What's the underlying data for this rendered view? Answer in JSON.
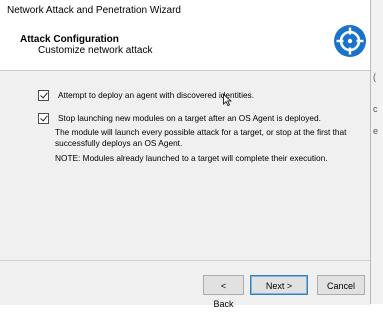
{
  "window": {
    "title": "Network Attack and Penetration Wizard"
  },
  "header": {
    "title": "Attack Configuration",
    "subtitle": "Customize network attack",
    "logo_icon": "crosshair-target-icon"
  },
  "options": [
    {
      "label": "Attempt to deploy an agent with discovered identities.",
      "checked": true
    },
    {
      "label": "Stop launching new modules on a target after an OS Agent is deployed.",
      "checked": true
    }
  ],
  "description": {
    "line1": "The module will launch every possible attack for a target, or stop at the first that",
    "line2": "successfully deploys an OS Agent.",
    "note": "NOTE: Modules already launched to a target will complete their execution."
  },
  "buttons": {
    "back": "< Back",
    "next": "Next >",
    "cancel": "Cancel"
  },
  "colors": {
    "logo": "#1a73c8",
    "window_bg": "#f0f0f0"
  }
}
